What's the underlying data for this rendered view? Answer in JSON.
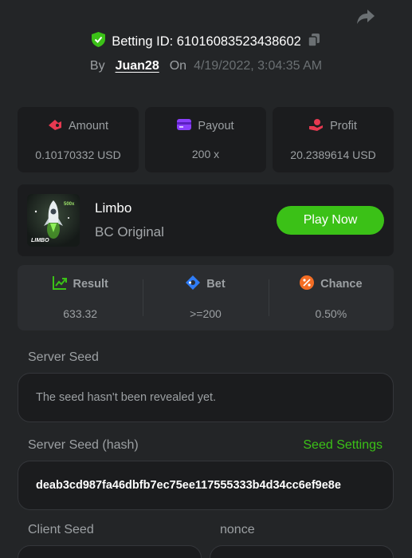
{
  "header": {
    "betting_id_label": "Betting ID: 61016083523438602",
    "by_label": "By",
    "user": "Juan28",
    "on_label": "On",
    "date": "4/19/2022, 3:04:35 AM"
  },
  "stats": [
    {
      "label": "Amount",
      "value": "0.10170332 USD",
      "icon": "amount-icon"
    },
    {
      "label": "Payout",
      "value": "200 x",
      "icon": "payout-icon"
    },
    {
      "label": "Profit",
      "value": "20.2389614 USD",
      "icon": "profit-icon"
    }
  ],
  "game": {
    "name": "Limbo",
    "subtitle": "BC Original",
    "play_label": "Play Now",
    "thumb_text": "LIMBO",
    "thumb_badge": "500x"
  },
  "results": [
    {
      "label": "Result",
      "value": "633.32",
      "icon": "result-icon"
    },
    {
      "label": "Bet",
      "value": ">=200",
      "icon": "bet-icon"
    },
    {
      "label": "Chance",
      "value": "0.50%",
      "icon": "chance-icon"
    }
  ],
  "server_seed": {
    "label": "Server Seed",
    "value": "The seed hasn't been revealed yet."
  },
  "server_seed_hash": {
    "label": "Server Seed (hash)",
    "settings_label": "Seed Settings",
    "value": "deab3cd987fa46dbfb7ec75ee117555333b4d34cc6ef9e8e"
  },
  "client_seed": {
    "label": "Client Seed"
  },
  "nonce": {
    "label": "nonce"
  },
  "colors": {
    "background": "#232527",
    "card": "#1b1c1e",
    "accent_green": "#3bc117"
  }
}
